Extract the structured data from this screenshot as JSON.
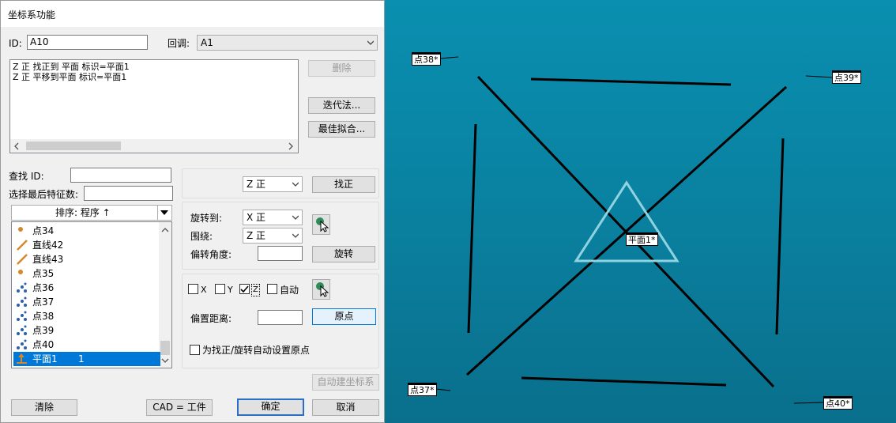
{
  "dialog": {
    "title": "坐标系功能",
    "id_label": "ID:",
    "id_value": "A10",
    "recall_label": "回调:",
    "recall_value": "A1",
    "commands": [
      "Z 正 找正到 平面 标识=平面1",
      "Z 正 平移到平面 标识=平面1"
    ],
    "buttons": {
      "delete": "删除",
      "iterative": "迭代法...",
      "best_fit": "最佳拟合...",
      "level": "找正",
      "rotate": "旋转",
      "origin": "原点",
      "auto_create": "自动建坐标系",
      "clear": "清除",
      "cad_equals_part": "CAD = 工件",
      "ok": "确定",
      "cancel": "取消"
    },
    "find_id_label": "查找 ID:",
    "find_id_value": "",
    "select_last_label": "选择最后特征数:",
    "select_last_value": "",
    "sort_header": "排序: 程序 ↑",
    "features": [
      {
        "name": "点34",
        "icon": "point-icon",
        "num": ""
      },
      {
        "name": "直线42",
        "icon": "line-icon",
        "num": ""
      },
      {
        "name": "直线43",
        "icon": "line-icon",
        "num": ""
      },
      {
        "name": "点35",
        "icon": "point-icon",
        "num": ""
      },
      {
        "name": "点36",
        "icon": "auto-point-icon",
        "num": ""
      },
      {
        "name": "点37",
        "icon": "auto-point-icon",
        "num": ""
      },
      {
        "name": "点38",
        "icon": "auto-point-icon",
        "num": ""
      },
      {
        "name": "点39",
        "icon": "auto-point-icon",
        "num": ""
      },
      {
        "name": "点40",
        "icon": "auto-point-icon",
        "num": ""
      },
      {
        "name": "平面1",
        "icon": "plane-icon",
        "num": "1"
      }
    ],
    "level_axis": "Z 正",
    "rotate_to_label": "旋转到:",
    "rotate_to_value": "X 正",
    "about_label": "围绕:",
    "about_value": "Z 正",
    "offset_angle_label": "偏转角度:",
    "offset_angle_value": "",
    "chk_x": "X",
    "chk_y": "Y",
    "chk_z": "Z",
    "chk_auto": "自动",
    "offset_distance_label": "偏置距离:",
    "offset_distance_value": "",
    "auto_origin_label": "为找正/旋转自动设置原点"
  },
  "viewport": {
    "labels": {
      "p38": "点38*",
      "p39": "点39*",
      "p37": "点37*",
      "p40": "点40*",
      "plane1": "平面1*"
    }
  },
  "colors": {
    "viewport_bg": "#0a86a6",
    "selection": "#0078d7",
    "triangle": "#8fd3e0"
  }
}
